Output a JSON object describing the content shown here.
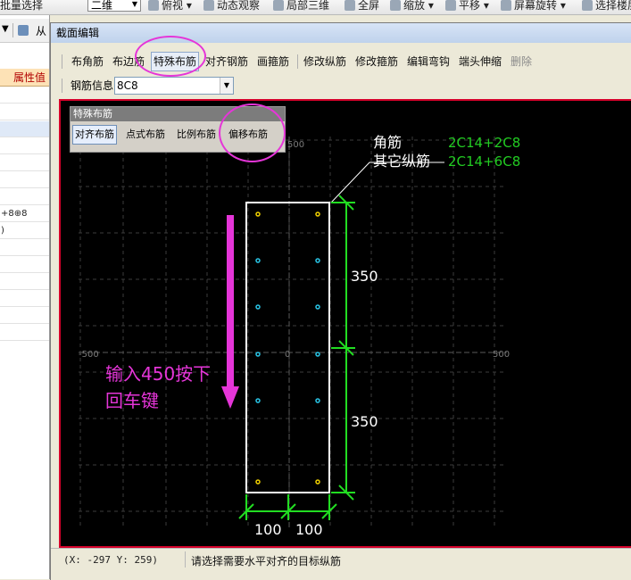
{
  "app_toolbar": {
    "batch_select_label": "批量选择",
    "view_mode_value": "二维",
    "view_dir_label": "俯视",
    "dyn_observe_label": "动态观察",
    "local_3d_label": "局部三维",
    "fullscreen_label": "全屏",
    "zoom_label": "缩放",
    "pan_label": "平移",
    "rotate_label": "屏幕旋转",
    "select_layer_label": "选择楼层"
  },
  "left_panel": {
    "from_label": "从",
    "attr_value_header": "属性值",
    "rows": [
      "",
      "",
      "",
      "",
      "",
      "",
      "",
      "+8⊕8",
      ")",
      "",
      "",
      "",
      "",
      "",
      ""
    ]
  },
  "dialog": {
    "title": "截面编辑",
    "toolbar": [
      "布角筋",
      "布边筋",
      "特殊布筋",
      "对齐钢筋",
      "画箍筋",
      "修改纵筋",
      "修改箍筋",
      "编辑弯钩",
      "端头伸缩",
      "删除"
    ],
    "rebar_info_label": "钢筋信息",
    "rebar_info_value": "8C8"
  },
  "palette": {
    "title": "特殊布筋",
    "buttons": [
      "对齐布筋",
      "点式布筋",
      "比例布筋",
      "偏移布筋"
    ]
  },
  "canvas": {
    "corner_bar_label": "角筋",
    "corner_bar_value": "2C14+2C8",
    "other_bar_label": "其它纵筋",
    "other_bar_value": "2C14+6C8",
    "dim_upper": "350",
    "dim_lower": "350",
    "dim_left": "100",
    "dim_right": "100",
    "axis_neg": "-500",
    "axis_zero": "0",
    "axis_pos": "500",
    "axis_top": "500",
    "hint_line1": "输入450按下",
    "hint_line2": "回车键"
  },
  "status": {
    "coord": "(X: -297 Y: 259)",
    "message": "请选择需要水平对齐的目标纵筋"
  },
  "colors": {
    "canvas_bg": "#000000",
    "frame": "#d4002a",
    "dimension": "#22dd22",
    "section": "#ffffff",
    "annotation": "#e535d8",
    "label_value": "#22cc22"
  }
}
